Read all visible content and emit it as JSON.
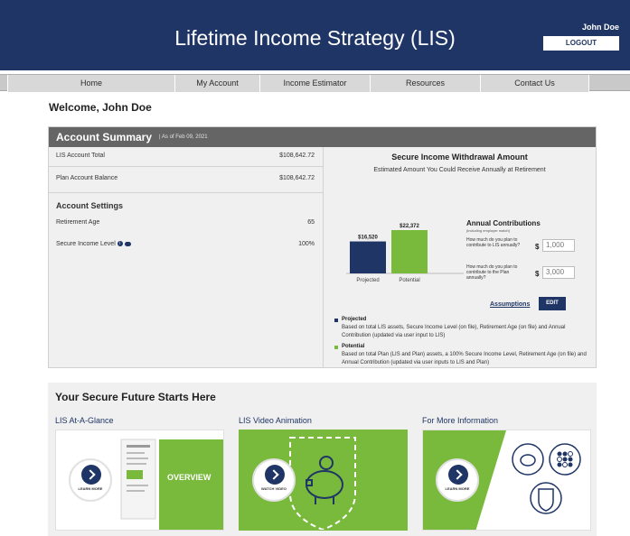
{
  "header": {
    "title": "Lifetime Income Strategy (LIS)",
    "user_name": "John Doe",
    "logout_label": "LOGOUT"
  },
  "nav": {
    "items": [
      "Home",
      "My Account",
      "Income Estimator",
      "Resources",
      "Contact Us"
    ]
  },
  "welcome": "Welcome, John Doe",
  "account_summary": {
    "title": "Account Summary",
    "as_of": "| As of Feb 09, 2021",
    "lis_total_label": "LIS Account Total",
    "lis_total_value": "$108,642.72",
    "plan_balance_label": "Plan Account Balance",
    "plan_balance_value": "$108,642.72",
    "settings_title": "Account Settings",
    "retirement_age_label": "Retirement Age",
    "retirement_age_value": "65",
    "secure_income_label": "Secure Income Level",
    "secure_income_value": "100%"
  },
  "withdrawal": {
    "title": "Secure Income Withdrawal Amount",
    "subtitle": "Estimated Amount You Could Receive Annually at Retirement"
  },
  "chart_data": {
    "type": "bar",
    "categories": [
      "Projected",
      "Potential"
    ],
    "values": [
      16520,
      22372
    ],
    "value_labels": [
      "$16,520",
      "$22,372"
    ],
    "colors": [
      "#1f3566",
      "#79b93c"
    ]
  },
  "annual_contributions": {
    "title": "Annual Contributions",
    "subtitle": "(including employer match)",
    "q1": "How much do you plan to contribute to LIS annually?",
    "q2": "How much do you plan to contribute to the Plan annually?",
    "currency": "$",
    "lis_value": "1,000",
    "plan_value": "3,000",
    "assumptions_label": "Assumptions",
    "edit_label": "EDIT"
  },
  "legend": {
    "projected_name": "Projected",
    "projected_desc": "Based on total LIS assets, Secure Income Level (on file), Retirement Age (on file) and Annual Contribution (updated via user input to LIS)",
    "potential_name": "Potential",
    "potential_desc": "Based on total Plan (LIS and Plan) assets, a 100% Secure Income Level, Retirement Age (on file) and Annual Contribution (updated via user inputs to LIS and Plan)"
  },
  "future": {
    "title": "Your Secure Future Starts Here",
    "cards": [
      {
        "label": "LIS At-A-Glance",
        "button": "LEARN MORE",
        "overlay": "OVERVIEW"
      },
      {
        "label": "LIS Video Animation",
        "button": "WATCH VIDEO"
      },
      {
        "label": "For More Information",
        "button": "LEARN MORE"
      }
    ]
  },
  "colors": {
    "navy": "#1f3566",
    "green": "#79b93c",
    "gray_header": "#656565"
  }
}
